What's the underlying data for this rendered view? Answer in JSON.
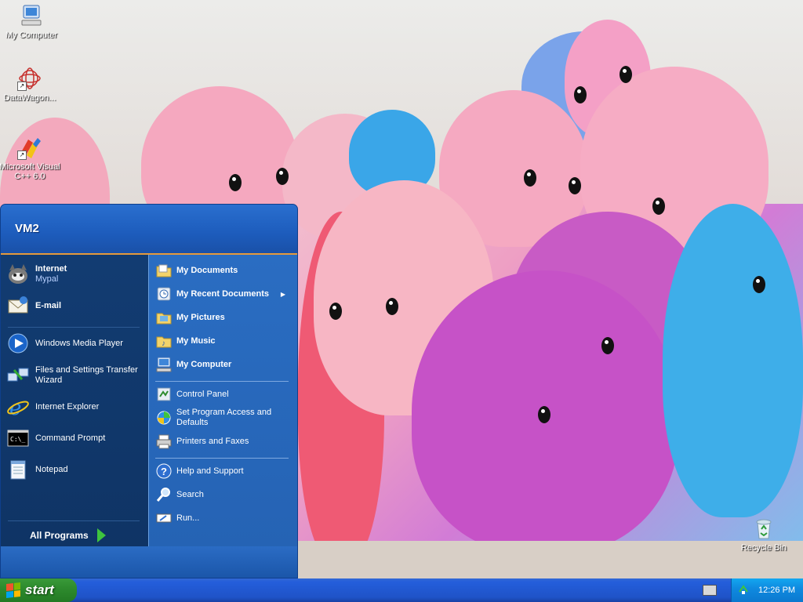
{
  "desktop": {
    "icons": [
      {
        "label": "My Computer",
        "icon": "my-computer-icon"
      },
      {
        "label": "DataWagon...",
        "icon": "datawagon-icon"
      },
      {
        "label": "Microsoft Visual C++ 6.0",
        "icon": "visual-cpp-icon"
      },
      {
        "label": "Recycle Bin",
        "icon": "recycle-bin-icon"
      }
    ]
  },
  "start_menu": {
    "user": "VM2",
    "pinned": [
      {
        "title": "Internet",
        "subtitle": "Mypal",
        "icon": "mypal-browser-icon"
      },
      {
        "title": "E-mail",
        "icon": "email-icon"
      }
    ],
    "recent": [
      {
        "label": "Windows Media Player",
        "icon": "media-player-icon"
      },
      {
        "label": "Files and Settings Transfer Wizard",
        "icon": "transfer-wizard-icon"
      },
      {
        "label": "Internet Explorer",
        "icon": "internet-explorer-icon"
      },
      {
        "label": "Command Prompt",
        "icon": "command-prompt-icon"
      },
      {
        "label": "Notepad",
        "icon": "notepad-icon"
      }
    ],
    "all_programs": "All Programs",
    "places": [
      {
        "label": "My Documents",
        "icon": "folder-icon"
      },
      {
        "label": "My Recent Documents",
        "icon": "recent-documents-icon",
        "has_submenu": true
      },
      {
        "label": "My Pictures",
        "icon": "pictures-folder-icon"
      },
      {
        "label": "My Music",
        "icon": "music-folder-icon"
      },
      {
        "label": "My Computer",
        "icon": "my-computer-icon"
      }
    ],
    "settings": [
      {
        "label": "Control Panel",
        "icon": "control-panel-icon"
      },
      {
        "label": "Set Program Access and Defaults",
        "icon": "program-access-icon"
      },
      {
        "label": "Printers and Faxes",
        "icon": "printer-icon"
      }
    ],
    "tools": [
      {
        "label": "Help and Support",
        "icon": "help-icon"
      },
      {
        "label": "Search",
        "icon": "search-icon"
      },
      {
        "label": "Run...",
        "icon": "run-icon"
      }
    ]
  },
  "taskbar": {
    "start_label": "start",
    "clock": "12:26 PM"
  },
  "colors": {
    "menu_blue": "#1f5fa8",
    "left_pane": "#123c72",
    "taskbar": "#245edb",
    "start_green": "#2e8b2e",
    "tray": "#0f8be0"
  }
}
